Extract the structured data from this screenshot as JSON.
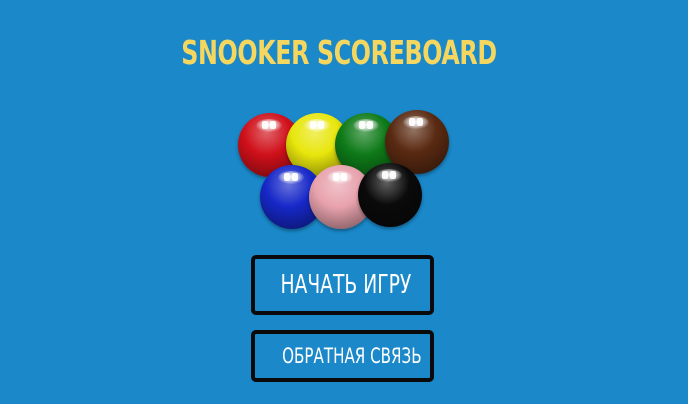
{
  "app": {
    "title": "SNOOKER SCOREBOARD",
    "background_color": "#1a88c9",
    "title_color": "#f5d760"
  },
  "balls": [
    {
      "name": "red-ball",
      "color": "#d0101a"
    },
    {
      "name": "yellow-ball",
      "color": "#e8e60c"
    },
    {
      "name": "green-ball",
      "color": "#0e7a18"
    },
    {
      "name": "brown-ball",
      "color": "#5a2a12"
    },
    {
      "name": "blue-ball",
      "color": "#1628c8"
    },
    {
      "name": "pink-ball",
      "color": "#e8a2ad"
    },
    {
      "name": "black-ball",
      "color": "#0a0a0a"
    }
  ],
  "menu": {
    "start_label": "НАЧАТЬ ИГРУ",
    "feedback_label": "ОБРАТНАЯ СВЯЗЬ"
  }
}
